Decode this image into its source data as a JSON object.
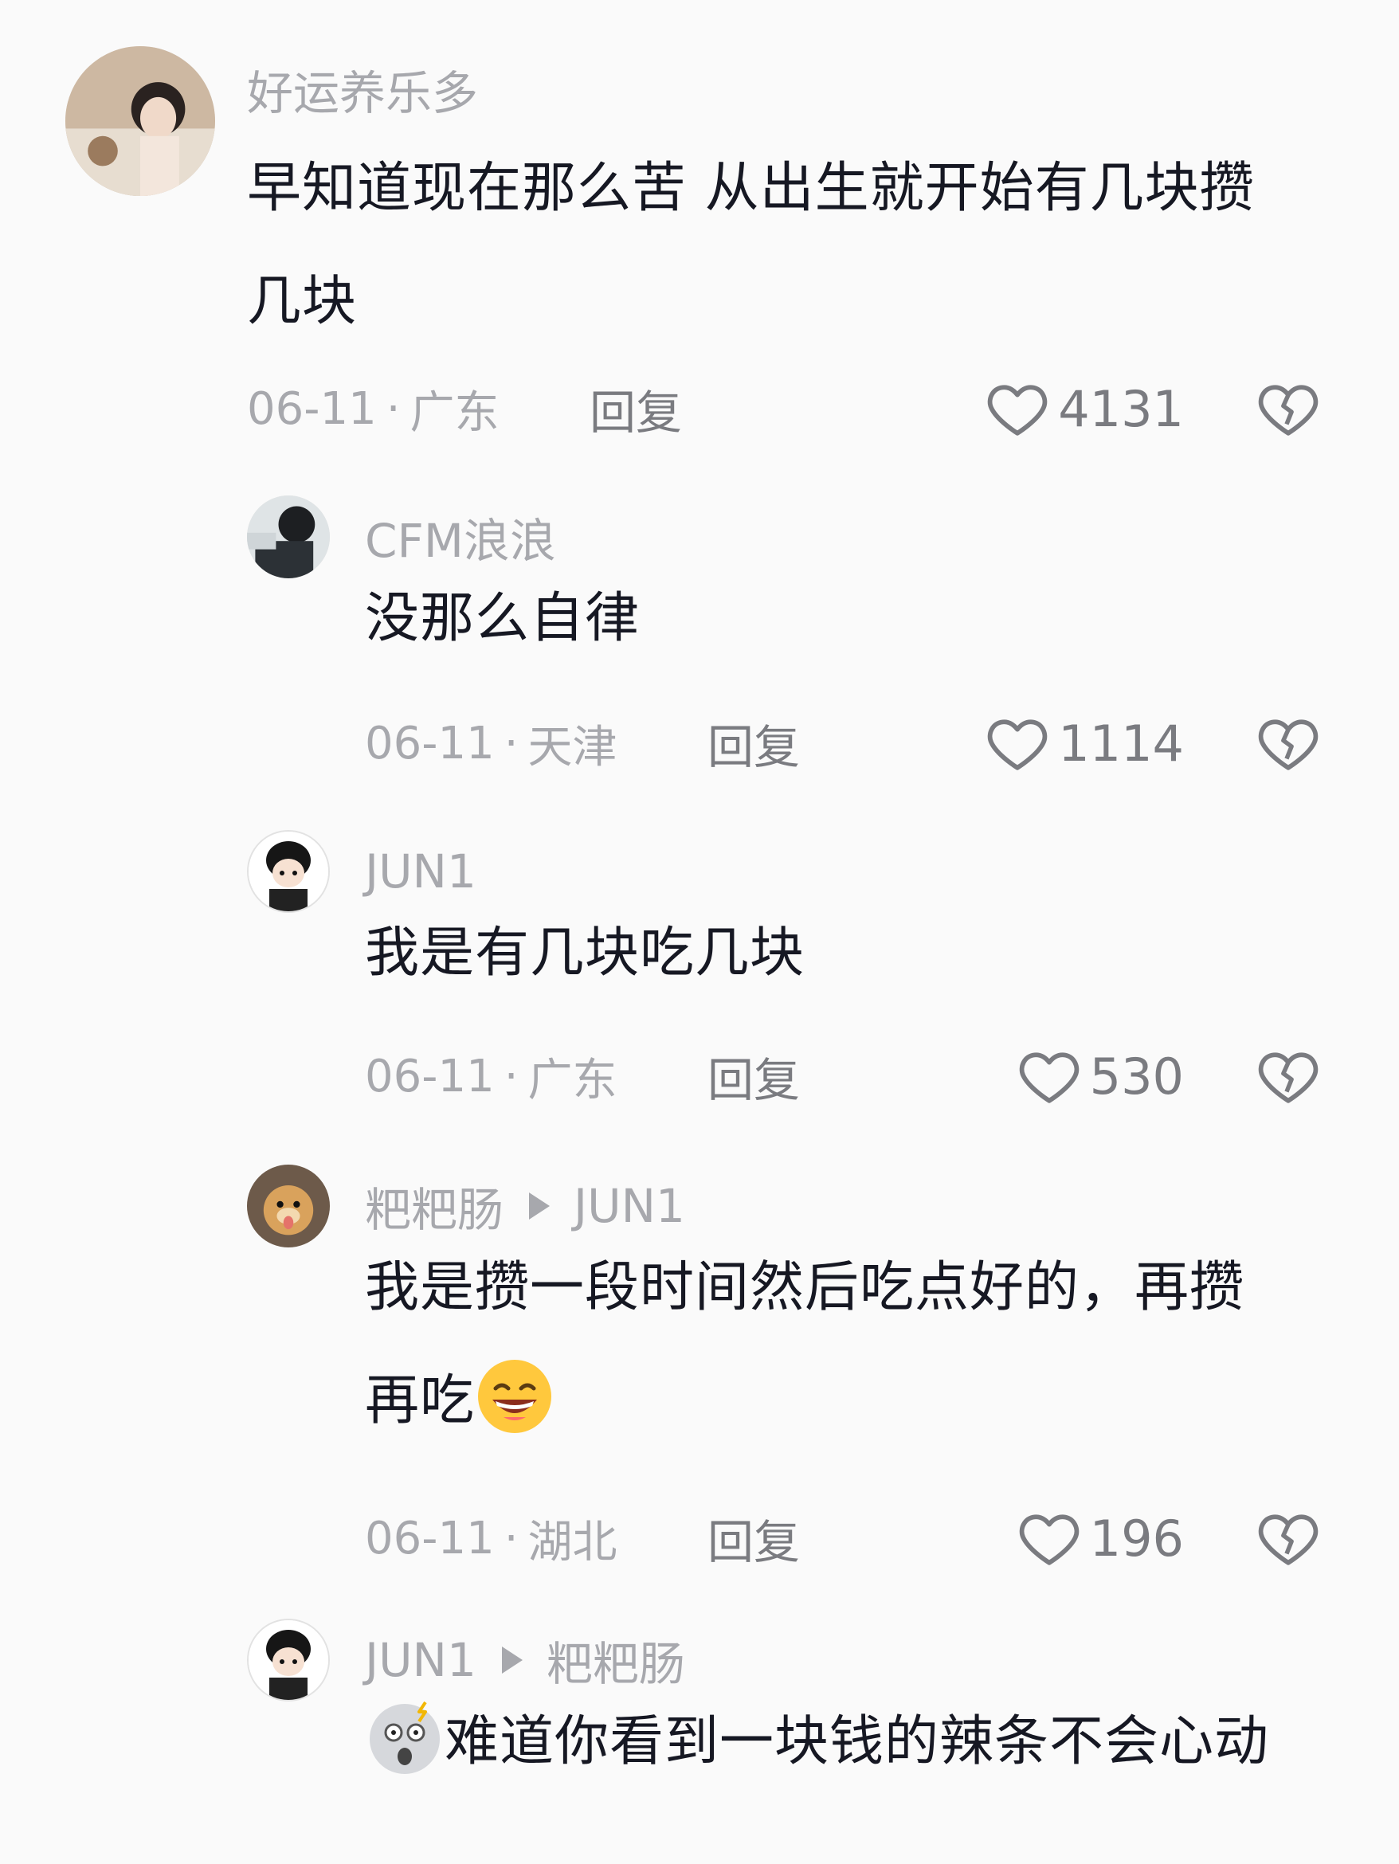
{
  "comments": [
    {
      "username": "好运养乐多",
      "text_line1": "早知道现在那么苦 从出生就开始有几块攒",
      "text_line2": "几块",
      "date": "06-11",
      "location": "广东",
      "reply_label": "回复",
      "likes": "4131"
    },
    {
      "username": "CFM浪浪",
      "text": "没那么自律",
      "date": "06-11",
      "location": "天津",
      "reply_label": "回复",
      "likes": "1114"
    },
    {
      "username": "JUN1",
      "text": "我是有几块吃几块",
      "date": "06-11",
      "location": "广东",
      "reply_label": "回复",
      "likes": "530"
    },
    {
      "username": "粑粑肠",
      "reply_to": "JUN1",
      "text_line1": "我是攒一段时间然后吃点好的，再攒",
      "text_line2": "再吃",
      "emoji": "grinning-emoji",
      "date": "06-11",
      "location": "湖北",
      "reply_label": "回复",
      "likes": "196"
    },
    {
      "username": "JUN1",
      "reply_to": "粑粑肠",
      "emoji": "shocked-emoji",
      "text": "难道你看到一块钱的辣条不会心动"
    }
  ],
  "icons": {
    "like": "heart-outline-icon",
    "dislike": "broken-heart-icon",
    "reply_indicator": "play-triangle-icon"
  },
  "colors": {
    "background": "#fafafa",
    "primary_text": "#161823",
    "secondary_text": "#a7a8ad",
    "action_text": "#7a7b80"
  }
}
